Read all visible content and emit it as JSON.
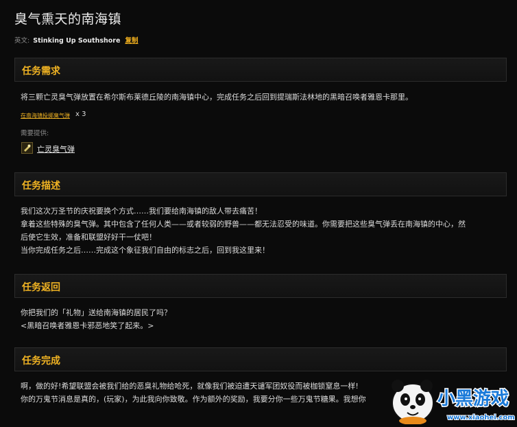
{
  "title": "臭气熏天的南海镇",
  "meta": {
    "en_label": "英文:",
    "en_name": "Stinking Up Southshore",
    "copy_label": "复制"
  },
  "requirements": {
    "heading": "任务需求",
    "text": "将三颗亡灵臭气弹放置在希尔斯布莱德丘陵的南海镇中心，完成任务之后回到提瑞斯法林地的黑暗召唤者雅恩卡那里。",
    "objective_link": "在南海镇投掷臭气弹",
    "objective_count": "x 3",
    "provided_label": "需要提供:",
    "provided_item": "亡灵臭气弹"
  },
  "description": {
    "heading": "任务描述",
    "lines": [
      "我们这次万圣节的庆祝要换个方式……我们要给南海镇的敌人带去痛苦！",
      "拿着这些特殊的臭气弹。其中包含了任何人类——或者较弱的野兽——都无法忍受的味道。你需要把这些臭气弹丢在南海镇的中心，然",
      "后使它生效，准备和联盟好好干一仗吧！",
      "当你完成任务之后……完成这个象征我们自由的标志之后，回到我这里来！"
    ]
  },
  "return": {
    "heading": "任务返回",
    "lines": [
      "你把我们的「礼物」送给南海镇的居民了吗？",
      "<黑暗召唤者雅恩卡邪恶地笑了起来。>"
    ]
  },
  "completion": {
    "heading": "任务完成",
    "lines": [
      "啊，做的好!希望联盟会被我们给的恶臭礼物给呛死，就像我们被迫遭天谴军团奴役而被枷锁窒息一样!",
      "你的万鬼节消息是真的，(玩家)，为此我向你致敬。作为额外的奖励，我要分你一些万鬼节糖果。我想你"
    ]
  },
  "watermark": {
    "brand_text": "小黑游戏",
    "url": "www.xiaohei.com"
  },
  "colors": {
    "accent": "#f0b323",
    "background": "#0b0b0b",
    "header_bg": "#151515",
    "text": "#dcdcdc"
  }
}
